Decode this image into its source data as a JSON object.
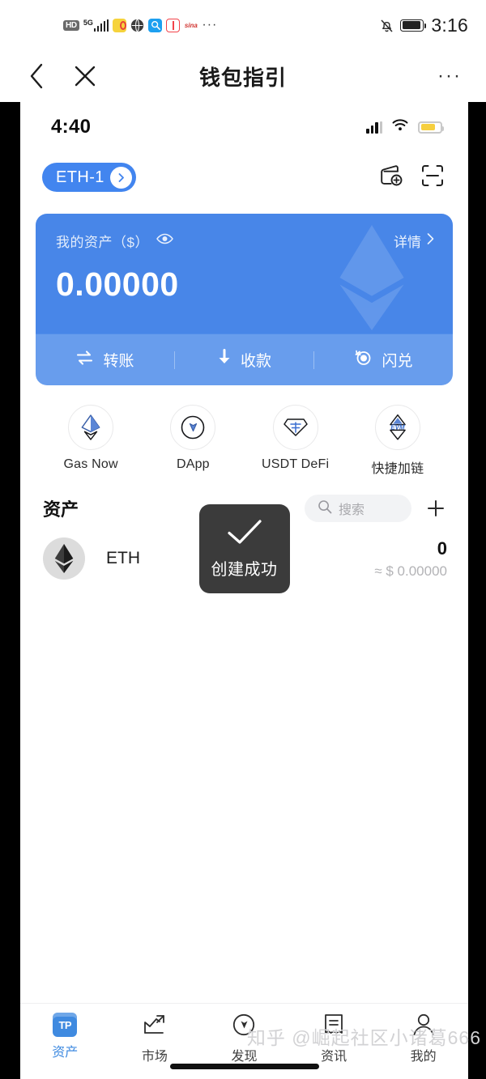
{
  "os_status": {
    "hd_badge": "HD",
    "network": "5G",
    "icons": [
      "weibo-icon",
      "globe-icon",
      "search-app-icon",
      "book-app-icon",
      "sina-icon"
    ],
    "overflow": "···",
    "mute_icon": "bell-muted-icon",
    "battery_icon": "battery-icon",
    "time": "3:16"
  },
  "nav": {
    "back_icon": "chevron-left-icon",
    "close_icon": "close-icon",
    "title": "钱包指引",
    "more_icon": "more-horizontal-icon",
    "more_glyph": "···"
  },
  "app": {
    "status": {
      "time": "4:40",
      "signal_icon": "cellular-icon",
      "wifi_icon": "wifi-icon",
      "battery_icon": "battery-icon"
    },
    "wallet_header": {
      "chip_label": "ETH-1",
      "chip_arrow_icon": "chevron-right-icon",
      "add_wallet_icon": "add-wallet-icon",
      "scan_icon": "scan-icon"
    },
    "balance_card": {
      "label": "我的资产（$）",
      "eye_icon": "eye-icon",
      "detail_label": "详情",
      "detail_arrow_icon": "chevron-right-icon",
      "amount": "0.00000",
      "bg_color": "#4886e8",
      "actions": [
        {
          "label": "转账",
          "icon": "transfer-icon"
        },
        {
          "label": "收款",
          "icon": "receive-icon"
        },
        {
          "label": "闪兑",
          "icon": "swap-icon"
        }
      ]
    },
    "shortcuts": [
      {
        "label": "Gas Now",
        "icon": "ethereum-gas-icon"
      },
      {
        "label": "DApp",
        "icon": "compass-icon"
      },
      {
        "label": "USDT DeFi",
        "icon": "usdt-defi-icon"
      },
      {
        "label": "快捷加链",
        "icon": "evm-chain-icon"
      }
    ],
    "assets": {
      "title": "资产",
      "search_icon": "search-icon",
      "search_value": "",
      "search_placeholder": "搜索",
      "add_icon": "plus-icon",
      "tokens": [
        {
          "symbol": "ETH",
          "icon": "ethereum-icon",
          "amount": "0",
          "usd_value": "≈ $ 0.00000"
        }
      ]
    },
    "toast": {
      "icon": "check-icon",
      "text": "创建成功",
      "bg_color": "#3b3b3b"
    },
    "tabbar": {
      "active_color": "#3f8ae0",
      "items": [
        {
          "label": "资产",
          "icon": "tokenpocket-logo-icon",
          "logo_text": "TP",
          "active": true
        },
        {
          "label": "市场",
          "icon": "chart-icon",
          "active": false
        },
        {
          "label": "发现",
          "icon": "compass-icon",
          "active": false
        },
        {
          "label": "资讯",
          "icon": "news-icon",
          "active": false
        },
        {
          "label": "我的",
          "icon": "person-icon",
          "active": false
        }
      ]
    }
  },
  "watermark": "知乎 @崛起社区小诸葛666"
}
